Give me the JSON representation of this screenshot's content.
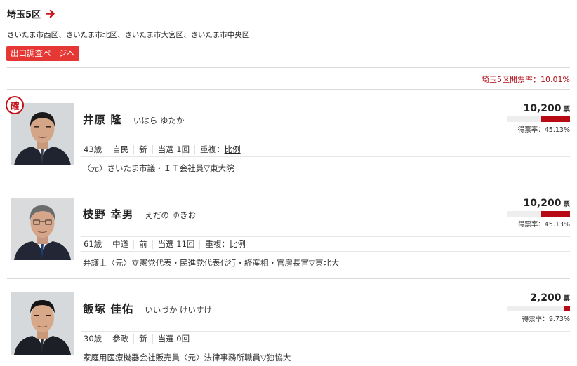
{
  "district": {
    "title": "埼玉5区",
    "areas": "さいたま市西区、さいたま市北区、さいたま市大宮区、さいたま市中央区",
    "exit_poll_label": "出口調査ページへ",
    "rate_label": "埼玉5区開票率：",
    "rate_value": "10.01%",
    "accent_color": "#b80a14"
  },
  "candidates": [
    {
      "name": "井原 隆",
      "kana": "いはら ゆたか",
      "elected": true,
      "elected_label": "確",
      "votes": "10,200",
      "vote_unit": "票",
      "share_label": "得票率：",
      "share_value": "45.13%",
      "share_fraction": 0.4513,
      "age": "43歳",
      "party": "自民",
      "status": "新",
      "times": "当選 1回",
      "dup_label": "重複：",
      "dup_link": "比例",
      "career": "〈元〉さいたま市議・ＩＴ会社員▽東大院"
    },
    {
      "name": "枝野 幸男",
      "kana": "えだの ゆきお",
      "elected": false,
      "elected_label": "",
      "votes": "10,200",
      "vote_unit": "票",
      "share_label": "得票率：",
      "share_value": "45.13%",
      "share_fraction": 0.4513,
      "age": "61歳",
      "party": "中道",
      "status": "前",
      "times": "当選 11回",
      "dup_label": "重複：",
      "dup_link": "比例",
      "career": "弁護士〈元〉立憲党代表・民進党代表代行・経産相・官房長官▽東北大"
    },
    {
      "name": "飯塚 佳佑",
      "kana": "いいづか けいすけ",
      "elected": false,
      "elected_label": "",
      "votes": "2,200",
      "vote_unit": "票",
      "share_label": "得票率：",
      "share_value": "9.73%",
      "share_fraction": 0.0973,
      "age": "30歳",
      "party": "参政",
      "status": "新",
      "times": "当選 0回",
      "dup_label": "",
      "dup_link": "",
      "career": "家庭用医療機器会社販売員〈元〉法律事務所職員▽独協大"
    }
  ]
}
